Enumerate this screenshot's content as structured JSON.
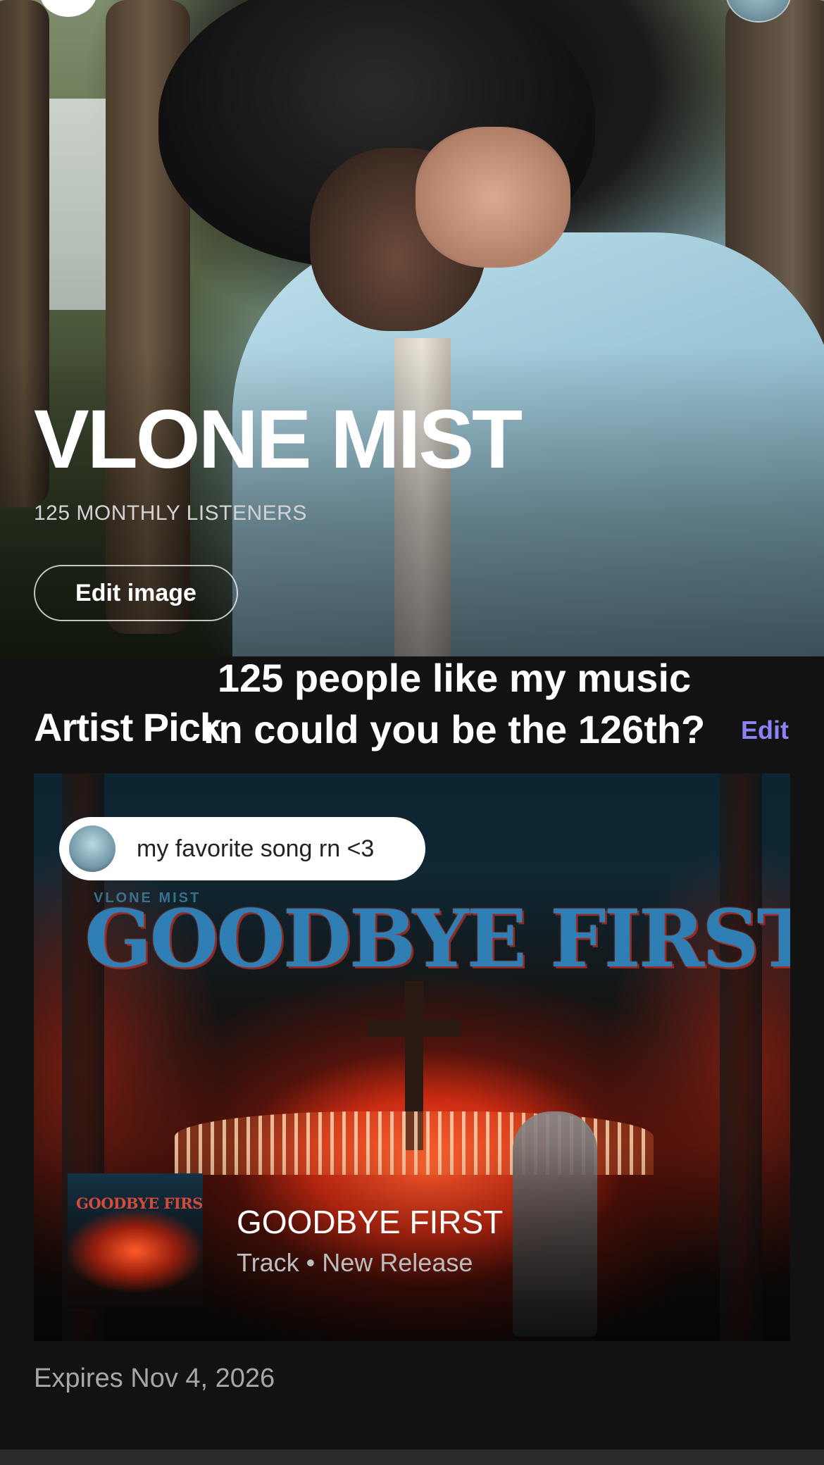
{
  "header": {
    "left_button_icon": "back-icon",
    "right_avatar": "profile-avatar"
  },
  "artist": {
    "name": "VLONE MIST",
    "monthly_listeners": "125 MONTHLY LISTENERS",
    "edit_image_label": "Edit image"
  },
  "caption_overlay": "125 people like my music rn could you be the 126th?",
  "artist_pick": {
    "section_title": "Artist Pick",
    "edit_label": "Edit",
    "accent_color": "#8b83f7",
    "comment": "my favorite song rn <3",
    "cover_artist_text": "VLONE MIST",
    "cover_title_text": "GOODBYE FIRST",
    "track": {
      "thumbnail_title": "GOODBYE FIRST",
      "title": "GOODBYE FIRST",
      "meta": "Track • New Release"
    },
    "expires": "Expires Nov 4, 2026"
  }
}
